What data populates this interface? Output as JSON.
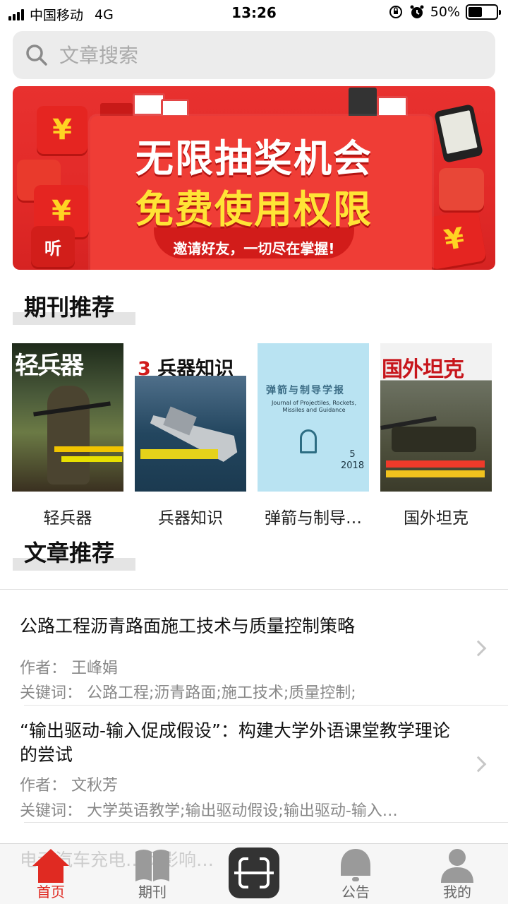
{
  "status_bar": {
    "carrier": "中国移动",
    "network": "4G",
    "time": "13:26",
    "battery_text": "50%",
    "battery_level": 0.5
  },
  "search": {
    "placeholder": "文章搜索"
  },
  "banner": {
    "headline": "无限抽奖机会",
    "subheadline": "免费使用权限",
    "tagline": "邀请好友，一切尽在掌握!",
    "yen_symbol": "¥",
    "app_badge": "听"
  },
  "journals_section": {
    "title": "期刊推荐",
    "items": [
      {
        "name": "轻兵器",
        "cover_masthead": "轻兵器"
      },
      {
        "name": "兵器知识",
        "cover_masthead": "兵器知识",
        "cover_issue": "3"
      },
      {
        "name": "弹箭与制导…",
        "cover_masthead": "弹箭与制导学报",
        "cover_subtitle": "Journal of Projectiles, Rockets, Missiles and Guidance",
        "cover_issue": "5",
        "cover_year": "2018"
      },
      {
        "name": "国外坦克",
        "cover_masthead": "国外坦克"
      }
    ]
  },
  "articles_section": {
    "title": "文章推荐",
    "items": [
      {
        "title": "公路工程沥青路面施工技术与质量控制策略",
        "author_label": "作者：",
        "author": "王峰娟",
        "keywords_label": "关键词：",
        "keywords": "公路工程;沥青路面;施工技术;质量控制;"
      },
      {
        "title": "“输出驱动-输入促成假设”：构建大学外语课堂教学理论的尝试",
        "author_label": "作者：",
        "author": "文秋芳",
        "keywords_label": "关键词：",
        "keywords": "大学英语教学;输出驱动假设;输出驱动-输入…"
      }
    ]
  },
  "tabbar": {
    "ghost_text": "电动汽车充电…网影响…",
    "tabs": [
      {
        "label": "首页",
        "icon": "home-icon",
        "active": true
      },
      {
        "label": "期刊",
        "icon": "book-icon",
        "active": false
      },
      {
        "label": "",
        "icon": "scan-icon",
        "active": false
      },
      {
        "label": "公告",
        "icon": "bell-icon",
        "active": false
      },
      {
        "label": "我的",
        "icon": "user-icon",
        "active": false
      }
    ],
    "active_color": "#e02a22"
  }
}
